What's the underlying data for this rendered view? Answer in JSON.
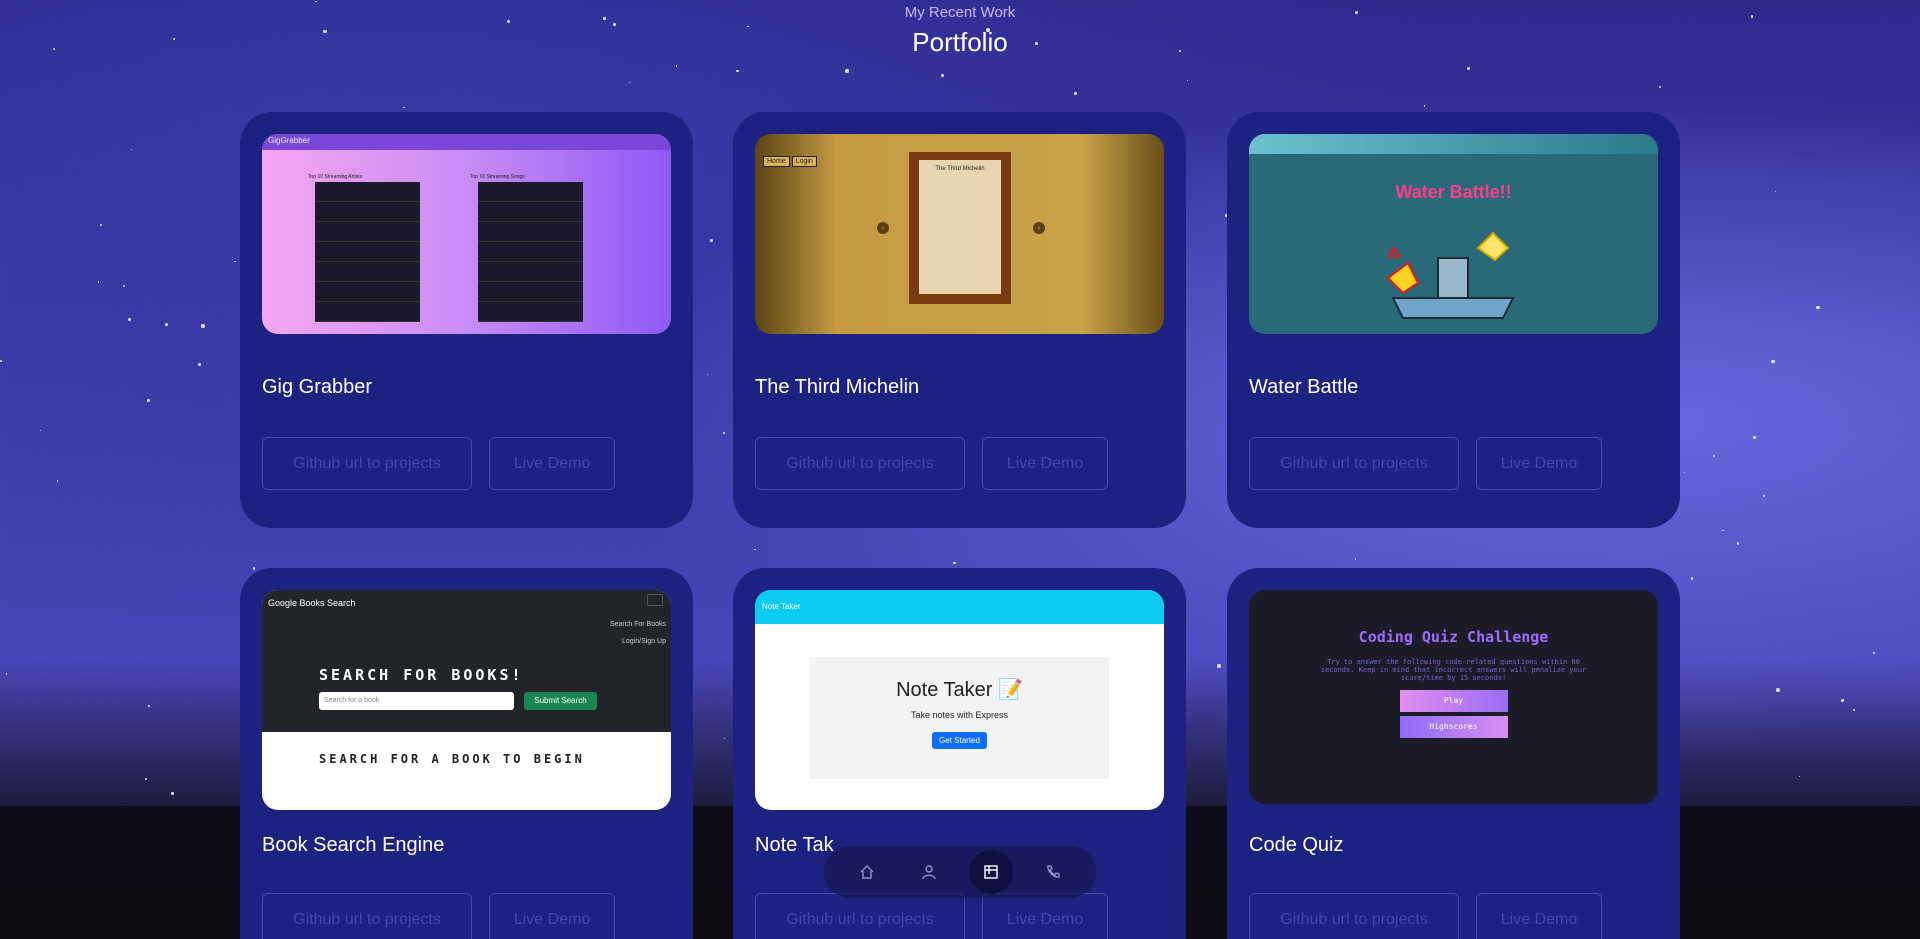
{
  "header": {
    "subtitle": "My Recent Work",
    "title": "Portfolio"
  },
  "projects": [
    {
      "title": "Gig Grabber",
      "github_label": "Github url to projects",
      "demo_label": "Live Demo",
      "thumb": {
        "brand": "GigGrabber",
        "left_heading": "Top 10 Streaming Artists",
        "right_heading": "Top 10 Streaming Songs"
      }
    },
    {
      "title": "The Third Michelin",
      "github_label": "Github url to projects",
      "demo_label": "Live Demo",
      "thumb": {
        "nav_home": "Home",
        "nav_login": "Login",
        "page_heading": "The Third Michelin"
      }
    },
    {
      "title": "Water Battle",
      "github_label": "Github url to projects",
      "demo_label": "Live Demo",
      "thumb": {
        "heading": "Water Battle!!"
      }
    },
    {
      "title": "Book Search Engine",
      "github_label": "Github url to projects",
      "demo_label": "Live Demo",
      "thumb": {
        "brand": "Google Books Search",
        "link1": "Search For Books",
        "link2": "Login/Sign Up",
        "hero": "SEARCH FOR BOOKS!",
        "placeholder": "Search for a book",
        "submit": "Submit Search",
        "begin": "SEARCH FOR A BOOK TO BEGIN"
      }
    },
    {
      "title": "Note Tak",
      "github_label": "Github url to projects",
      "demo_label": "Live Demo",
      "thumb": {
        "brand": "Note Taker",
        "heading": "Note Taker 📝",
        "sub": "Take notes with Express",
        "cta": "Get Started"
      }
    },
    {
      "title": "Code Quiz",
      "github_label": "Github url to projects",
      "demo_label": "Live Demo",
      "thumb": {
        "heading": "Coding Quiz Challenge",
        "desc": "Try to answer the following code-related questions within 60 seconds. Keep in mind that incorrect answers will penalize your score/time by 15 seconds!",
        "play": "Play",
        "highscores": "Highscores"
      }
    }
  ],
  "bottom_nav": {
    "items": [
      "home-icon",
      "user-icon",
      "portfolio-icon",
      "phone-icon"
    ],
    "active": "portfolio-icon"
  },
  "colors": {
    "card_bg": "#1d2281",
    "button_border": "#3e4aa8",
    "subtitle": "#c9b6ff"
  }
}
